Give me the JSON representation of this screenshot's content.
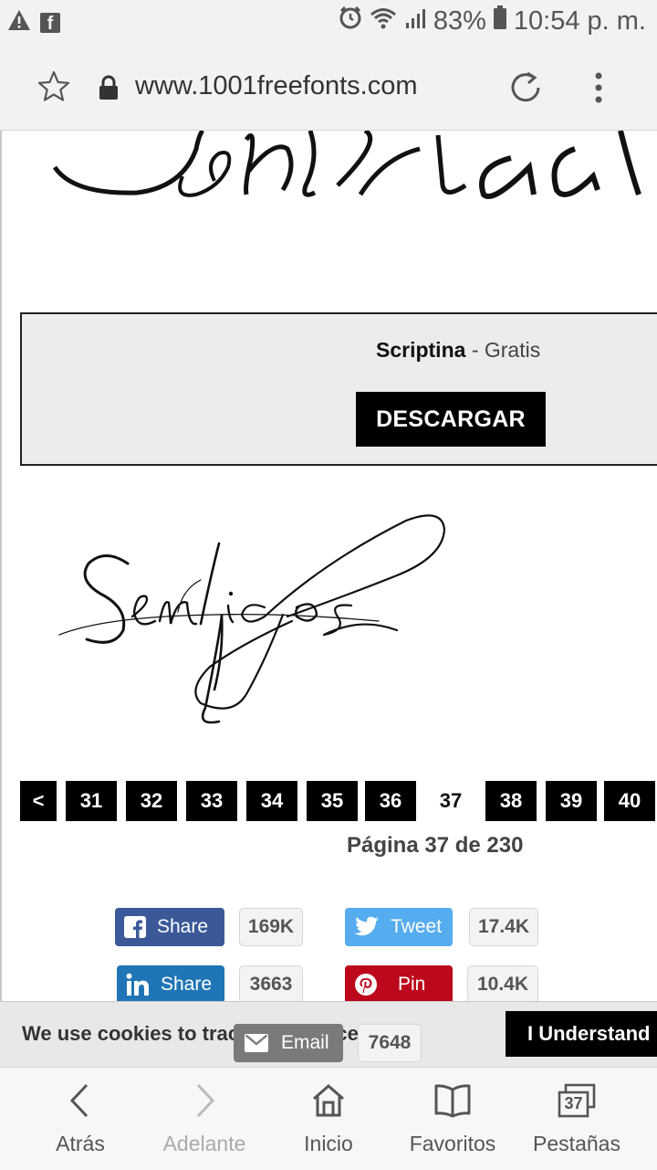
{
  "status_bar": {
    "battery": "83%",
    "time": "10:54 p. m."
  },
  "browser": {
    "url": "www.1001freefonts.com"
  },
  "font_listing": {
    "name": "Scriptina",
    "license": "- Gratis",
    "download_label": "DESCARGAR"
  },
  "pagination": {
    "prev_label": "<",
    "pages": [
      "31",
      "32",
      "33",
      "34",
      "35",
      "36",
      "37",
      "38",
      "39",
      "40"
    ],
    "current": "37",
    "page_info": "Página 37 de 230"
  },
  "share": {
    "facebook": {
      "label": "Share",
      "count": "169K",
      "color": "#3b5998"
    },
    "twitter": {
      "label": "Tweet",
      "count": "17.4K",
      "color": "#55acee"
    },
    "linkedin": {
      "label": "Share",
      "count": "3663",
      "color": "#1f75b5"
    },
    "pinterest": {
      "label": "Pin",
      "count": "10.4K",
      "color": "#bd081c"
    },
    "email": {
      "label": "Email",
      "count": "7648",
      "color": "#7a7a7a"
    }
  },
  "cookie_bar": {
    "text": "We use cookies to track preferences.",
    "button": "I Understand"
  },
  "bottom_nav": {
    "back": "Atrás",
    "forward": "Adelante",
    "home": "Inicio",
    "bookmarks": "Favoritos",
    "tabs": "Pestañas",
    "tab_count": "37"
  }
}
